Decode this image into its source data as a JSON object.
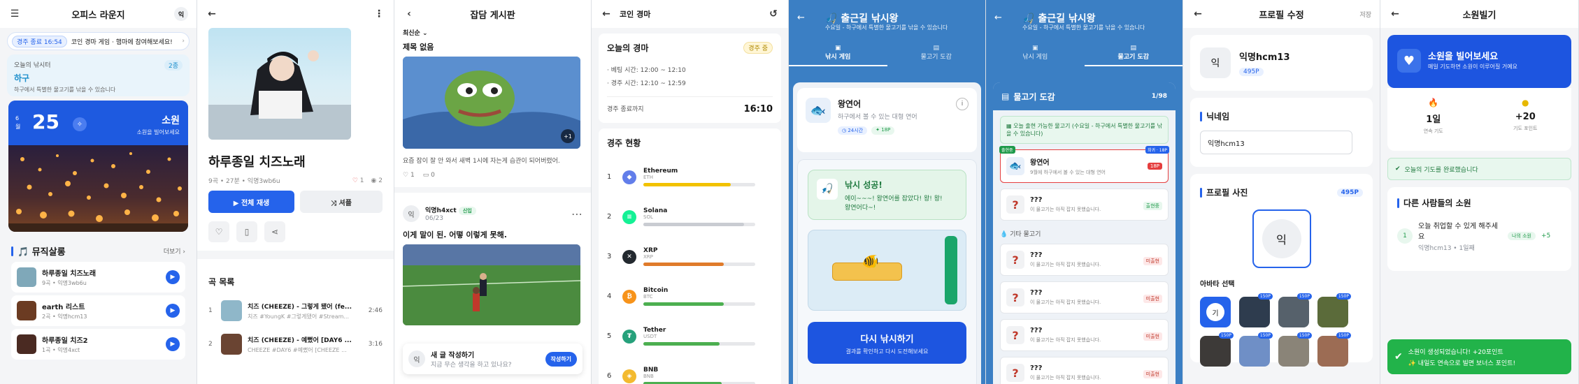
{
  "s1": {
    "title": "오피스 라운지",
    "avatar": "익",
    "banner_pill": "경주 종료 16:54",
    "banner_text": "코인 경마 게임 · 햄마에 참여해보세요!",
    "fish_label": "오늘의 낚시터",
    "fish_tag": "2종",
    "fish_name": "하구",
    "fish_desc": "하구에서 특별한 물고기를 낚을 수 있습니다",
    "wish_month": "6\n월",
    "wish_day": "25",
    "wish_label": "소원",
    "wish_sub": "소원을 빌어보세요",
    "music_title": "🎵 뮤직살롱",
    "music_more": "더보기",
    "songs": [
      {
        "t": "하루종일 치즈노래",
        "s": "9곡 • 익명3wb6u"
      },
      {
        "t": "earth 리스트",
        "s": "2곡 • 익명hcm13"
      },
      {
        "t": "하루종일 치즈2",
        "s": "1곡 • 익명4xct"
      }
    ]
  },
  "s2": {
    "title": "하루종일 치즈노래",
    "meta": "9곡 • 27분 • 익명3wb6u",
    "likes": "1",
    "views": "2",
    "play_all": "▶  전체 재생",
    "shuffle": "⤨  셔플",
    "list_title": "곡 목록",
    "tracks": [
      {
        "n": "1",
        "t": "치즈 (CHEEZE) - 그렇게 됐어 (fe...",
        "s": "치즈 #YoungK #그렇게됐어 #Stream...",
        "d": "2:46"
      },
      {
        "n": "2",
        "t": "치즈 (CHEEZE) - 예뻤어 [DAY6 ...",
        "s": "CHEEZE #DAY6 #예뻤어 [CHEEZE ...",
        "d": "3:16"
      }
    ]
  },
  "s3": {
    "title": "잡담 게시판",
    "sort": "최신순",
    "post1_title": "제목 없음",
    "post1_body": "요즘 잠이 잘 안 와서 새벽 1시에 자는게 습관이 되어버렸어.",
    "post1_likes": "1",
    "post1_comments": "0",
    "post1_more": "+1",
    "author": "익명h4xct",
    "author_badge": "신입",
    "author_date": "06/23",
    "post2_title": "이게 말이 된. 어떻 이렇게 못해.",
    "compose_title": "새 글 작성하기",
    "compose_sub": "지금 무슨 생각을 하고 있나요?",
    "compose_btn": "작성하기",
    "compose_av": "익"
  },
  "s4": {
    "title": "코인 경마",
    "race_title": "오늘의 경마",
    "race_tag": "경주 중",
    "bet_time": "· 베팅 시간: 12:00 ~ 12:10",
    "race_time": "· 경주 시간: 12:10 ~ 12:59",
    "end_label": "경주 종료까지",
    "end_time": "16:10",
    "status_title": "경주 현황",
    "coins": [
      {
        "rk": "1",
        "nm": "Ethereum",
        "sy": "ETH",
        "c": "#627eea",
        "bar": "#f2c200",
        "p": 0.78,
        "g": "◆"
      },
      {
        "rk": "2",
        "nm": "Solana",
        "sy": "SOL",
        "c": "#14f195",
        "bar": "#c9ccd2",
        "p": 0.9,
        "g": "≡"
      },
      {
        "rk": "3",
        "nm": "XRP",
        "sy": "XRP",
        "c": "#23292f",
        "bar": "#e07b2a",
        "p": 0.72,
        "g": "✕"
      },
      {
        "rk": "4",
        "nm": "Bitcoin",
        "sy": "BTC",
        "c": "#f7931a",
        "bar": "#4caf50",
        "p": 0.72,
        "g": "₿"
      },
      {
        "rk": "5",
        "nm": "Tether",
        "sy": "USDT",
        "c": "#26a17b",
        "bar": "#4caf50",
        "p": 0.68,
        "g": "₮"
      },
      {
        "rk": "6",
        "nm": "BNB",
        "sy": "BNB",
        "c": "#f3ba2f",
        "bar": "#4caf50",
        "p": 0.7,
        "g": "◈"
      }
    ]
  },
  "s5": {
    "title": "출근길 낚시왕",
    "sub": "수요일 - 하구에서 특별한 물고기를 낚을 수 있습니다",
    "tab1": "낚시 게임",
    "tab2": "물고기 도감",
    "fish_name": "왕연어",
    "fish_desc": "하구에서 볼 수 있는 대형 연어",
    "fish_time": "24시간",
    "fish_pts": "18P",
    "success_title": "낚시 성공!",
    "success_body": "에이~~~! 왕연어를 잡았다! 왕! 왕! 왕연어다~!",
    "again": "다시 낚시하기",
    "again_sub": "결과를 확인하고 다시 도전해보세요"
  },
  "s6": {
    "dex_title": "물고기 도감",
    "dex_count": "1/98",
    "notice": "오늘 출현 가능한 물고기 (수요일 - 하구에서 특별한 물고기를 낚을 수 있습니다)",
    "caught_badge": "18P",
    "entry1_nm": "왕연어",
    "entry1_ds": "9월에 하구에서 볼 수 있는 대형 연어",
    "entry2_nm": "???",
    "entry2_ds": "이 물고기는 아직 잡지 못했습니다.",
    "entry2_badge": "출현중",
    "others": "기타 물고기",
    "locked_nm": "???",
    "locked_ds": "이 물고기는 아직 잡지 못했습니다.",
    "locked_badge": "미출현",
    "tag_special": "출현중",
    "tag_rare": "희귀 · 18P"
  },
  "s7": {
    "title": "프로필 수정",
    "save": "저장",
    "avatar": "익",
    "name": "익명hcm13",
    "points": "495P",
    "nick_label": "닉네임",
    "nick_value": "익명hcm13",
    "photo_label": "프로필 사진",
    "photo_points": "495P",
    "avatar_choice": "아바타 선택",
    "avatars": [
      {
        "cost": "",
        "k": "기"
      },
      {
        "cost": "150P"
      },
      {
        "cost": "150P"
      },
      {
        "cost": "150P"
      },
      {
        "cost": "150P"
      },
      {
        "cost": "150P"
      },
      {
        "cost": "150P"
      },
      {
        "cost": "150P"
      }
    ]
  },
  "s8": {
    "title": "소원빌기",
    "hero_title": "소원을 빌어보세요",
    "hero_sub": "매일 기도하면 소원이 이루어질 거예요",
    "streak_v": "1일",
    "streak_l": "연속 기도",
    "pts_v": "+20",
    "pts_l": "기도 포인트",
    "done": "오늘의 기도를 완료했습니다",
    "others_title": "다른 사람들의 소원",
    "wish_num": "1",
    "wish_text": "오늘 취업할 수 있게 해주세요",
    "wish_by": "익명hcm13 • 1일째",
    "wish_badge": "나의 소원",
    "wish_plus": "+5",
    "toast1": "소원이 생성되었습니다! +20포인트",
    "toast2": "✨ 내일도 연속으로 빌면 보너스 포인트!"
  }
}
